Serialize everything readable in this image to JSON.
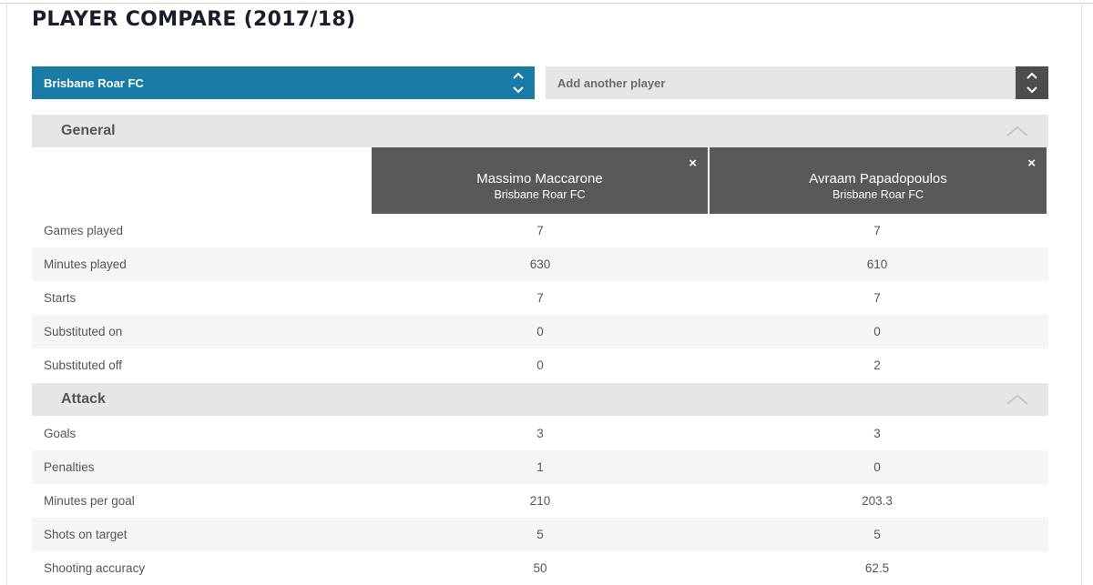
{
  "page": {
    "title": "PLAYER COMPARE (2017/18)"
  },
  "selectors": {
    "team": {
      "value": "Brisbane Roar FC"
    },
    "player": {
      "placeholder": "Add another player"
    }
  },
  "players": [
    {
      "name": "Massimo Maccarone",
      "team": "Brisbane Roar FC"
    },
    {
      "name": "Avraam Papadopoulos",
      "team": "Brisbane Roar FC"
    }
  ],
  "sections": {
    "general": {
      "title": "General",
      "rows": [
        {
          "label": "Games played",
          "p1": "7",
          "p2": "7"
        },
        {
          "label": "Minutes played",
          "p1": "630",
          "p2": "610"
        },
        {
          "label": "Starts",
          "p1": "7",
          "p2": "7"
        },
        {
          "label": "Substituted on",
          "p1": "0",
          "p2": "0"
        },
        {
          "label": "Substituted off",
          "p1": "0",
          "p2": "2"
        }
      ]
    },
    "attack": {
      "title": "Attack",
      "rows": [
        {
          "label": "Goals",
          "p1": "3",
          "p2": "3"
        },
        {
          "label": "Penalties",
          "p1": "1",
          "p2": "0"
        },
        {
          "label": "Minutes per goal",
          "p1": "210",
          "p2": "203.3"
        },
        {
          "label": "Shots on target",
          "p1": "5",
          "p2": "5"
        },
        {
          "label": "Shooting accuracy",
          "p1": "50",
          "p2": "62.5"
        }
      ]
    }
  },
  "icons": {
    "close": "×",
    "selector_arrows": "chevron-up-down-icon",
    "collapse": "chevron-up-icon"
  },
  "colors": {
    "team_selector_bg": "#1a7ba7",
    "player_header_bg": "#595959",
    "section_bg": "#e6e6e6",
    "alt_row_bg": "#f5f5f5"
  }
}
